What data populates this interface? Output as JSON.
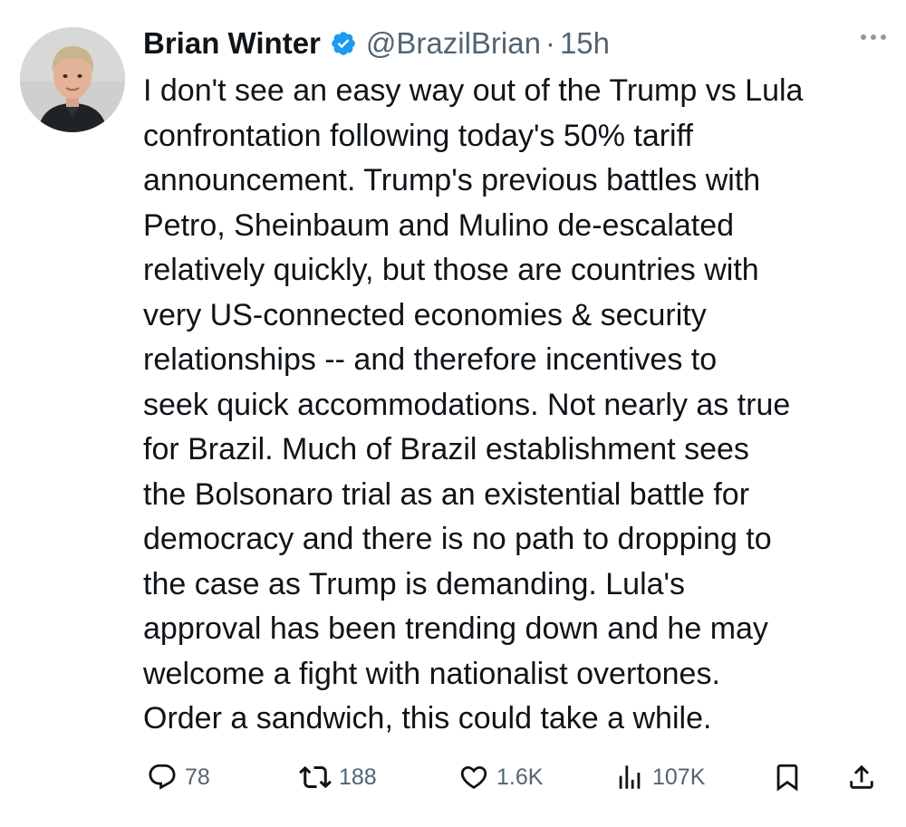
{
  "author": {
    "display_name": "Brian Winter",
    "handle": "@BrazilBrian",
    "separator": "·",
    "timestamp": "15h",
    "verified": true,
    "verified_color": "#1d9bf0"
  },
  "tweet": {
    "text": "I don't see an easy way out of the Trump vs Lula\nconfrontation following today's 50% tariff\nannouncement. Trump's previous battles with\nPetro, Sheinbaum and Mulino de-escalated\nrelatively quickly, but those are countries with\nvery US-connected economies & security\nrelationships -- and therefore incentives to\nseek quick accommodations. Not nearly as true\nfor Brazil. Much of Brazil establishment sees\nthe Bolsonaro trial as an existential battle for\ndemocracy and there is no path to dropping to\nthe case as Trump is demanding. Lula's\napproval has been trending down and he may\nwelcome a fight with nationalist overtones.\nOrder a sandwich, this could take a while."
  },
  "actions": {
    "reply": {
      "icon": "reply-icon",
      "count": "78"
    },
    "retweet": {
      "icon": "retweet-icon",
      "count": "188"
    },
    "like": {
      "icon": "heart-icon",
      "count": "1.6K"
    },
    "views": {
      "icon": "views-icon",
      "count": "107K"
    },
    "bookmark": {
      "icon": "bookmark-icon"
    },
    "share": {
      "icon": "share-icon"
    }
  },
  "colors": {
    "text_primary": "#0f1419",
    "text_secondary": "#536471",
    "background": "#ffffff"
  }
}
